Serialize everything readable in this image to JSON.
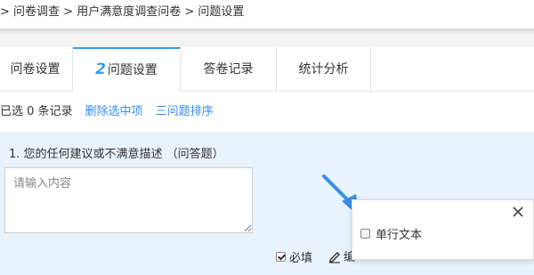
{
  "breadcrumb": {
    "item1": "> 问卷调查",
    "sep1": " > ",
    "item2": "用户满意度调查问卷",
    "sep2": " > ",
    "item3": "问题设置"
  },
  "tabs": [
    {
      "label": "问卷设置"
    },
    {
      "num": "2",
      "label": "问题设置"
    },
    {
      "label": "答卷记录"
    },
    {
      "label": "统计分析"
    }
  ],
  "toolbar": {
    "selected_text": "已选 0 条记录",
    "delete_selected": "删除选中项",
    "sort_questions": "三问题排序"
  },
  "question": {
    "title": "1. 您的任何建议或不满意描述 （问答题）",
    "placeholder": "请输入内容",
    "value": ""
  },
  "options": {
    "required_label": "必填",
    "edit_label": "编"
  },
  "popup": {
    "item_label": "单行文本"
  },
  "colors": {
    "accent": "#3e9ae8",
    "link": "#3a8ee6",
    "content_bg": "#e8f3fc",
    "arrow": "#3b8fe0"
  }
}
